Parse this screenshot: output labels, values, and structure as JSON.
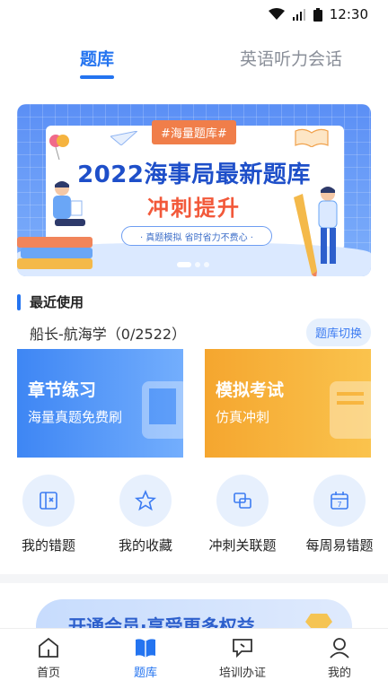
{
  "status_bar": {
    "time": "12:30"
  },
  "tabs": [
    {
      "label": "题库",
      "active": true
    },
    {
      "label": "英语听力会话",
      "active": false
    }
  ],
  "banner": {
    "tag": "#海量题库#",
    "title": "2022海事局最新题库",
    "subtitle": "冲刺提升",
    "pill": "· 真题模拟  省时省力不费心 ·",
    "slide_count": 3,
    "active_slide": 1
  },
  "recent": {
    "heading": "最近使用",
    "bank_name": "船长-航海学（0/2522）",
    "switch_label": "题库切换"
  },
  "cards": [
    {
      "title": "章节练习",
      "desc": "海量真题免费刷",
      "color": "#3e86f4"
    },
    {
      "title": "模拟考试",
      "desc": "仿真冲刺",
      "color": "#f5a62f"
    }
  ],
  "quick_actions": [
    {
      "label": "我的错题",
      "icon": "wrong-questions-icon"
    },
    {
      "label": "我的收藏",
      "icon": "star-icon"
    },
    {
      "label": "冲刺关联题",
      "icon": "linked-squares-icon"
    },
    {
      "label": "每周易错题",
      "icon": "calendar-icon"
    }
  ],
  "vip_banner": {
    "text": "开通会员·享受更多权益"
  },
  "bottom_nav": [
    {
      "label": "首页",
      "icon": "home-icon",
      "active": false
    },
    {
      "label": "题库",
      "icon": "book-icon",
      "active": true
    },
    {
      "label": "培训办证",
      "icon": "chat-icon",
      "active": false
    },
    {
      "label": "我的",
      "icon": "user-icon",
      "active": false
    }
  ],
  "colors": {
    "accent": "#2474f0",
    "orange": "#f5a62f",
    "red_text": "#f2593a"
  }
}
